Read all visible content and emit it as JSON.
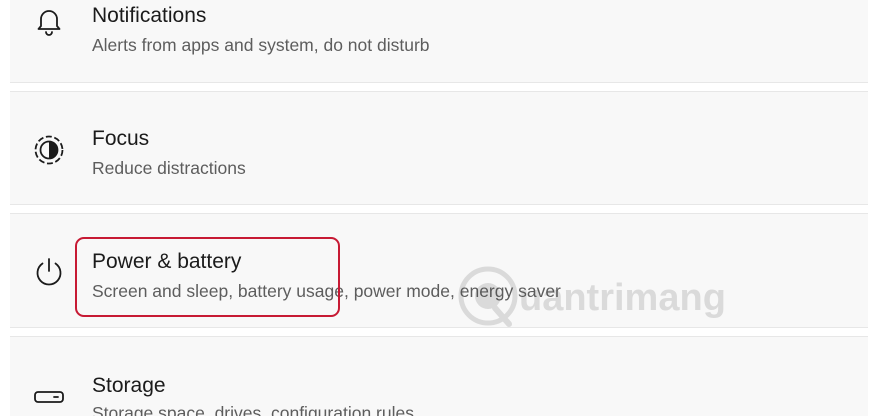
{
  "settings_list": {
    "items": [
      {
        "title": "Notifications",
        "subtitle": "Alerts from apps and system, do not disturb",
        "icon": "bell-icon"
      },
      {
        "title": "Focus",
        "subtitle": "Reduce distractions",
        "icon": "focus-icon"
      },
      {
        "title": "Power & battery",
        "subtitle": "Screen and sleep, battery usage, power mode, energy saver",
        "icon": "power-icon"
      },
      {
        "title": "Storage",
        "subtitle": "Storage space, drives, configuration rules",
        "icon": "storage-icon"
      }
    ]
  },
  "watermark": {
    "text": "uantrimang"
  },
  "colors": {
    "highlight": "#c71a34",
    "row_background": "#f8f8f8",
    "divider": "#e7e7e7"
  }
}
